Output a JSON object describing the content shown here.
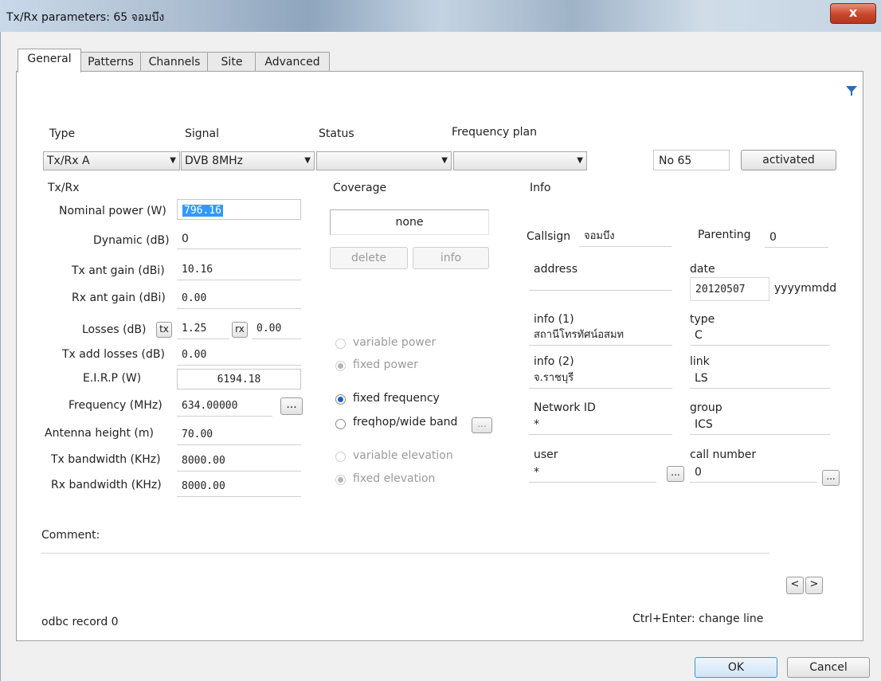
{
  "window": {
    "title": "Tx/Rx parameters: 65 จอมบึง",
    "close_symbol": "x"
  },
  "tabs": [
    "General",
    "Patterns",
    "Channels",
    "Site",
    "Advanced"
  ],
  "header": {
    "type_label": "Type",
    "signal_label": "Signal",
    "status_label": "Status",
    "freqplan_label": "Frequency plan",
    "type_value": "Tx/Rx A",
    "signal_value": "DVB 8MHz",
    "status_value": "",
    "freqplan_value": "",
    "number": "No 65",
    "activated_button": "activated"
  },
  "txrx": {
    "section_label": "Tx/Rx",
    "nominal_power_label": "Nominal power (W)",
    "nominal_power": "796.16",
    "dynamic_label": "Dynamic (dB)",
    "dynamic": "0",
    "tx_gain_label": "Tx ant gain (dBi)",
    "tx_gain": "10.16",
    "rx_gain_label": "Rx ant gain (dBi)",
    "rx_gain": "0.00",
    "losses_label": "Losses (dB)",
    "tx_button": "tx",
    "tx_losses": "1.25",
    "rx_button": "rx",
    "rx_losses": "0.00",
    "tx_add_losses_label": "Tx add losses (dB)",
    "tx_add_losses": "0.00",
    "eirp_label": "E.I.R.P (W)",
    "eirp": "6194.18",
    "frequency_label": "Frequency (MHz)",
    "frequency": "634.00000",
    "ellipsis": "...",
    "antenna_height_label": "Antenna height (m)",
    "antenna_height": "70.00",
    "tx_bw_label": "Tx bandwidth (KHz)",
    "tx_bw": "8000.00",
    "rx_bw_label": "Rx bandwidth (KHz)",
    "rx_bw": "8000.00"
  },
  "coverage": {
    "label": "Coverage",
    "value": "none",
    "delete_button": "delete",
    "info_button": "info",
    "variable_power": "variable power",
    "fixed_power": "fixed power",
    "fixed_frequency": "fixed frequency",
    "freqhop": "freqhop/wide band",
    "variable_elevation": "variable elevation",
    "fixed_elevation": "fixed elevation"
  },
  "info": {
    "label": "Info",
    "callsign_label": "Callsign",
    "callsign": "จอมบึง",
    "parenting_label": "Parenting",
    "parenting": "0",
    "address_label": "address",
    "address": "",
    "date_label": "date",
    "date": "20120507",
    "date_format": "yyyymmdd",
    "info1_label": "info (1)",
    "info1": "สถานีโทรทัศน์อสมท",
    "type_label": "type",
    "type": "C",
    "info2_label": "info (2)",
    "info2": "จ.ราชบุรี",
    "link_label": "link",
    "link": "LS",
    "network_label": "Network ID",
    "network": "*",
    "group_label": "group",
    "group": "ICS",
    "user_label": "user",
    "user": "*",
    "call_number_label": "call number",
    "call_number": "0"
  },
  "footer": {
    "comment_label": "Comment:",
    "prev": "<",
    "next": ">",
    "odbc": "odbc record 0",
    "hint": "Ctrl+Enter: change line",
    "ok": "OK",
    "cancel": "Cancel"
  },
  "colors": {
    "accent": "#1c5ec8",
    "selection": "#3399ff",
    "filter_icon": "#2a6cc4"
  }
}
